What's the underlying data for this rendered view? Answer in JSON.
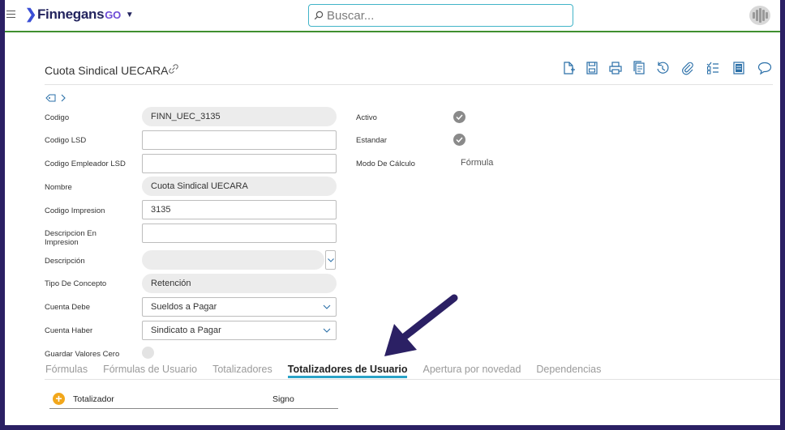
{
  "header": {
    "app_name": "Finnegans",
    "app_suffix": "GO",
    "search_placeholder": "Buscar..."
  },
  "page": {
    "title": "Cuota Sindical UECARA",
    "toolbar_icons": [
      "new-document-icon",
      "save-icon",
      "print-icon",
      "copy-icon",
      "history-icon",
      "attachment-icon",
      "checklist-icon",
      "report-icon",
      "comment-icon"
    ]
  },
  "form": {
    "codigo": {
      "label": "Codigo",
      "value": "FINN_UEC_3135"
    },
    "codigo_lsd": {
      "label": "Codigo LSD",
      "value": ""
    },
    "codigo_empleador_lsd": {
      "label": "Codigo Empleador LSD",
      "value": ""
    },
    "nombre": {
      "label": "Nombre",
      "value": "Cuota Sindical UECARA"
    },
    "codigo_impresion": {
      "label": "Codigo Impresion",
      "value": "3135"
    },
    "descripcion_impresion": {
      "label_line1": "Descripcion En",
      "label_line2": "Impresion",
      "value": ""
    },
    "descripcion": {
      "label": "Descripción",
      "value": ""
    },
    "tipo_concepto": {
      "label": "Tipo De Concepto",
      "value": "Retención"
    },
    "cuenta_debe": {
      "label": "Cuenta Debe",
      "value": "Sueldos a Pagar"
    },
    "cuenta_haber": {
      "label": "Cuenta Haber",
      "value": "Sindicato a Pagar"
    },
    "guardar_valores_cero": {
      "label": "Guardar Valores Cero",
      "checked": false
    }
  },
  "right_panel": {
    "activo": {
      "label": "Activo",
      "checked": true
    },
    "estandar": {
      "label": "Estandar",
      "checked": true
    },
    "modo_calculo": {
      "label": "Modo De Cálculo",
      "value": "Fórmula"
    }
  },
  "tabs": [
    {
      "label": "Fórmulas",
      "active": false
    },
    {
      "label": "Fórmulas de Usuario",
      "active": false
    },
    {
      "label": "Totalizadores",
      "active": false
    },
    {
      "label": "Totalizadores de Usuario",
      "active": true
    },
    {
      "label": "Apertura por novedad",
      "active": false
    },
    {
      "label": "Dependencias",
      "active": false
    }
  ],
  "grid": {
    "columns": [
      "Totalizador",
      "Signo"
    ],
    "rows": []
  },
  "colors": {
    "frame_border": "#2b2064",
    "accent": "#2aa3c8",
    "topline": "#3f8f2f",
    "annotation_arrow": "#2b2064"
  }
}
